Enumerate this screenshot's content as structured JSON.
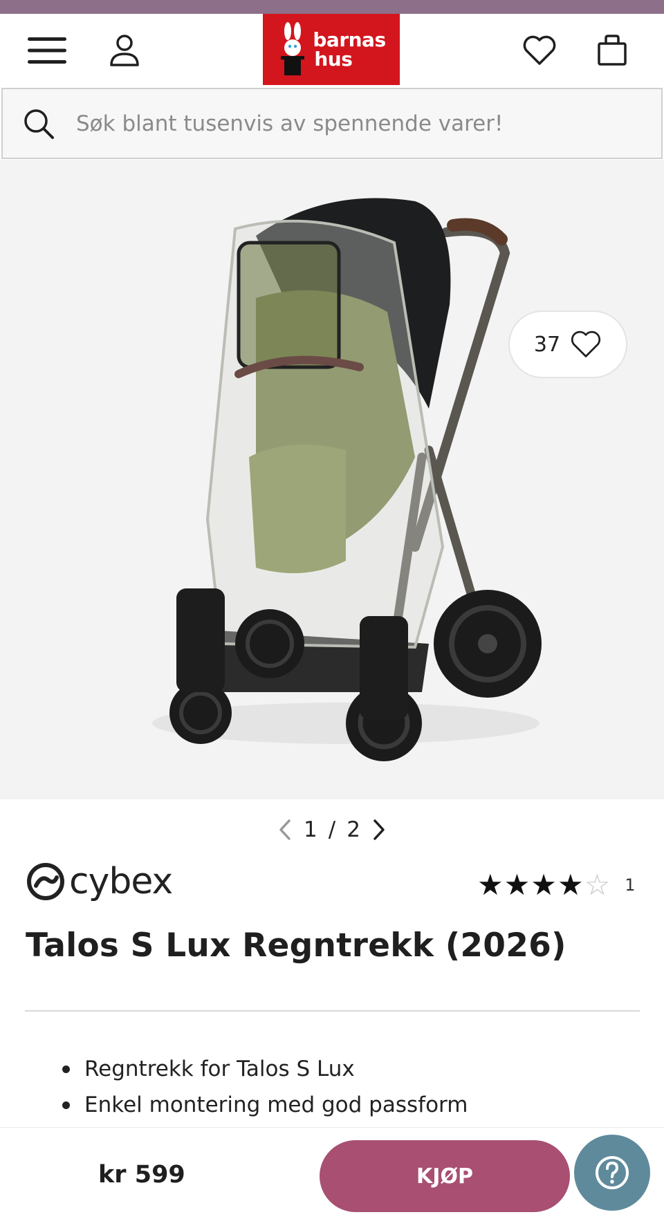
{
  "header": {
    "logo_line1": "barnas",
    "logo_line2": "hus"
  },
  "search": {
    "placeholder": "Søk blant tusenvis av spennende varer!"
  },
  "gallery": {
    "favorite_count": "37",
    "pager_current": "1",
    "pager_separator": "/",
    "pager_total": "2"
  },
  "product": {
    "brand": "cybex",
    "rating_value": 4,
    "rating_max": 5,
    "rating_count": "1",
    "title": "Talos S Lux Regntrekk (2026)",
    "features": [
      "Regntrekk for Talos S Lux",
      "Enkel montering med god passform"
    ]
  },
  "bottom_bar": {
    "price": "kr 599",
    "buy_label": "KJØP"
  },
  "colors": {
    "top_strip": "#8e6f8a",
    "logo_bg": "#d3151d",
    "buy_button": "#a84f72",
    "help_button": "#5f8a9c"
  }
}
